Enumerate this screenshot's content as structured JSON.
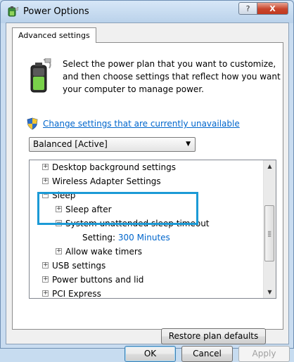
{
  "window": {
    "title": "Power Options",
    "help_symbol": "?",
    "close_symbol": "X"
  },
  "tab": {
    "label": "Advanced settings"
  },
  "intro": {
    "line1": "Select the power plan that you want to customize,",
    "line2": "and then choose settings that reflect how you want",
    "line3": "your computer to manage power."
  },
  "change_link": "Change settings that are currently unavailable",
  "plan_select": {
    "value": "Balanced [Active]"
  },
  "tree": {
    "items": [
      {
        "symbol": "+",
        "label": "Desktop background settings"
      },
      {
        "symbol": "+",
        "label": "Wireless Adapter Settings"
      },
      {
        "symbol": "−",
        "label": "Sleep"
      },
      {
        "symbol": "+",
        "label": "Sleep after"
      },
      {
        "symbol": "−",
        "label": "System unattended sleep timeout"
      },
      {
        "label": "Setting:",
        "value": "300 Minutes"
      },
      {
        "symbol": "+",
        "label": "Allow wake timers"
      },
      {
        "symbol": "+",
        "label": "USB settings"
      },
      {
        "symbol": "+",
        "label": "Power buttons and lid"
      },
      {
        "symbol": "+",
        "label": "PCI Express"
      }
    ]
  },
  "buttons": {
    "restore": "Restore plan defaults",
    "ok": "OK",
    "cancel": "Cancel",
    "apply": "Apply"
  },
  "colors": {
    "highlight_border": "#1b9ad6",
    "link": "#0066cc"
  },
  "icons": {
    "title": "power-options-icon",
    "battery": "battery-plug-icon",
    "shield": "uac-shield-icon"
  }
}
